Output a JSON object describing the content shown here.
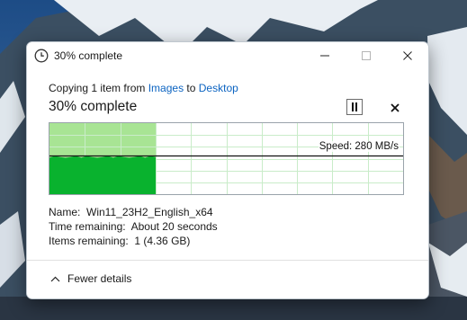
{
  "window": {
    "title": "30% complete"
  },
  "copy": {
    "prefix": "Copying 1 item from ",
    "source": "Images",
    "middle": " to ",
    "destination": "Desktop"
  },
  "progress": {
    "heading": "30% complete",
    "fraction": 0.3
  },
  "graph": {
    "speed_text": "Speed: 280 MB/s"
  },
  "details": {
    "name_label": "Name:",
    "name_value": "Win11_23H2_English_x64",
    "time_label": "Time remaining:",
    "time_value": "About 20 seconds",
    "items_label": "Items remaining:",
    "items_value": "1 (4.36 GB)"
  },
  "footer": {
    "toggle_label": "Fewer details"
  },
  "colors": {
    "progress_fill": "#a8e494",
    "throughput_fill": "#09b22e",
    "link": "#0b63c1"
  },
  "icons": [
    "clock-icon",
    "minimize-icon",
    "maximize-icon",
    "close-icon",
    "pause-icon",
    "cancel-icon",
    "chevron-up-icon"
  ]
}
